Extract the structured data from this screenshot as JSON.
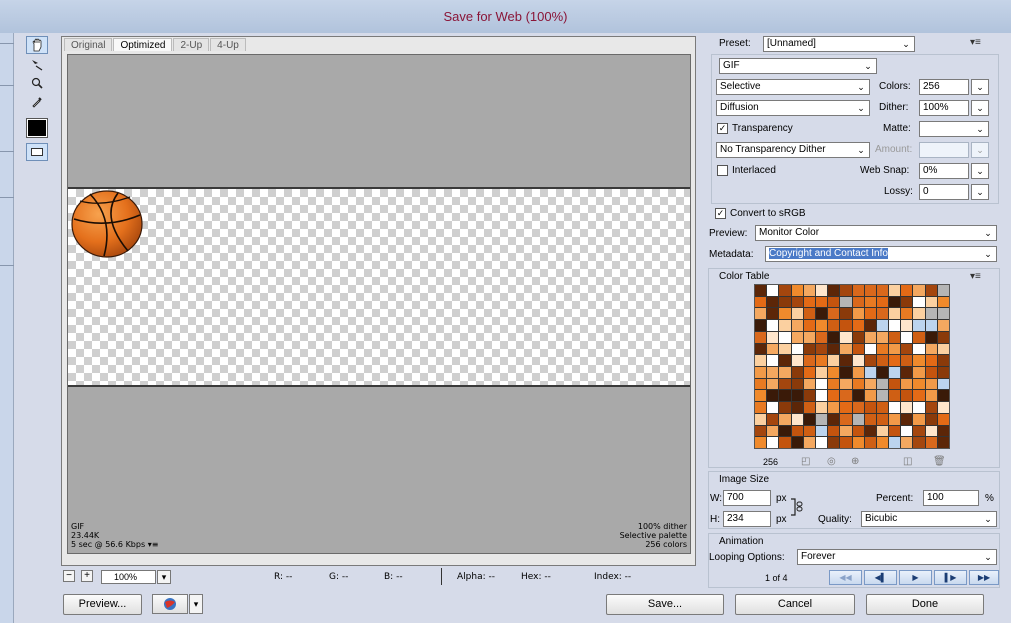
{
  "window": {
    "title": "Save for Web (100%)"
  },
  "tools": [
    {
      "icon": "hand-icon",
      "glyph": "☝"
    },
    {
      "icon": "slice-select-icon",
      "glyph": "⌁"
    },
    {
      "icon": "zoom-icon",
      "glyph": "🔍︎"
    },
    {
      "icon": "eyedropper-icon",
      "glyph": "✎"
    }
  ],
  "tabs": [
    "Original",
    "Optimized",
    "2-Up",
    "4-Up"
  ],
  "active_tab": "Optimized",
  "status": {
    "format": "GIF",
    "size": "23.44K",
    "download": "5 sec @ 56.6 Kbps",
    "dither": "100% dither",
    "palette": "Selective palette",
    "colors": "256 colors"
  },
  "bottom": {
    "zoom": "100%",
    "r": "R: --",
    "g": "G: --",
    "b": "B: --",
    "alpha": "Alpha: --",
    "hex": "Hex: --",
    "index": "Index: --"
  },
  "buttons": {
    "preview": "Preview...",
    "save": "Save...",
    "cancel": "Cancel",
    "done": "Done"
  },
  "settings": {
    "preset_label": "Preset:",
    "preset_value": "[Unnamed]",
    "format": "GIF",
    "reduction": "Selective",
    "colors_label": "Colors:",
    "colors_value": "256",
    "dither_algo": "Diffusion",
    "dither_label": "Dither:",
    "dither_value": "100%",
    "transparency_label": "Transparency",
    "transparency_checked": true,
    "matte_label": "Matte:",
    "matte_value": "",
    "transparency_dither": "No Transparency Dither",
    "amount_label": "Amount:",
    "amount_value": "",
    "interlaced_label": "Interlaced",
    "interlaced_checked": false,
    "websnap_label": "Web Snap:",
    "websnap_value": "0%",
    "lossy_label": "Lossy:",
    "lossy_value": "0",
    "convert_srgb_label": "Convert to sRGB",
    "convert_srgb_checked": true,
    "preview_label": "Preview:",
    "preview_value": "Monitor Color",
    "metadata_label": "Metadata:",
    "metadata_value": "Copyright and Contact Info"
  },
  "color_table": {
    "title": "Color Table",
    "count": "256",
    "palette": [
      "#e36a16",
      "#f08a2c",
      "#c4540e",
      "#8a3a0a",
      "#f4a860",
      "#d9681c",
      "#fbd0a0",
      "#3a1a08",
      "#ffffff",
      "#b5b5b5",
      "#e87a22",
      "#a4460e",
      "#f29a48",
      "#cf5f14",
      "#5c2608",
      "#ffe6cc",
      "#bcd4ee"
    ]
  },
  "image_size": {
    "title": "Image Size",
    "w_label": "W:",
    "w_value": "700",
    "h_label": "H:",
    "h_value": "234",
    "unit": "px",
    "percent_label": "Percent:",
    "percent_value": "100",
    "percent_unit": "%",
    "quality_label": "Quality:",
    "quality_value": "Bicubic"
  },
  "animation": {
    "title": "Animation",
    "looping_label": "Looping Options:",
    "looping_value": "Forever",
    "frame": "1 of 4"
  }
}
